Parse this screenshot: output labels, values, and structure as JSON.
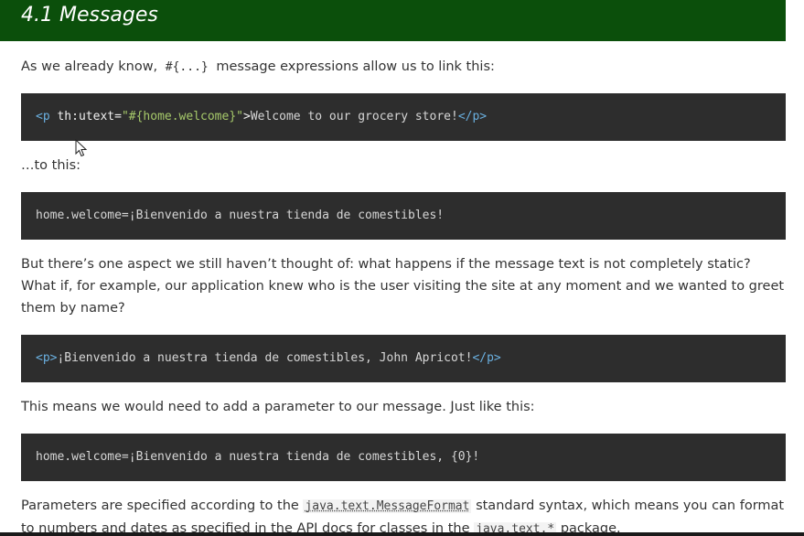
{
  "section": {
    "title": "4.1 Messages"
  },
  "para1": {
    "before": "As we already know,",
    "code": "#{...}",
    "after": "message expressions allow us to link this:"
  },
  "code1": {
    "open_tag": "<p",
    "attr": " th:utext=",
    "value": "\"#{home.welcome}\"",
    "close_bracket": ">",
    "text": "Welcome to our grocery store!",
    "end_tag": "</p>"
  },
  "para2": {
    "text": "…to this:"
  },
  "code2": {
    "text": "home.welcome=¡Bienvenido a nuestra tienda de comestibles!"
  },
  "para3": {
    "text": "But there’s one aspect we still haven’t thought of: what happens if the message text is not completely static? What if, for example, our application knew who is the user visiting the site at any moment and we wanted to greet them by name?"
  },
  "code3": {
    "open_tag": "<p>",
    "text": "¡Bienvenido a nuestra tienda de comestibles, John Apricot!",
    "end_tag": "</p>"
  },
  "para4": {
    "text": "This means we would need to add a parameter to our message. Just like this:"
  },
  "code4": {
    "text": "home.welcome=¡Bienvenido a nuestra tienda de comestibles, {0}!"
  },
  "para5": {
    "before": "Parameters are specified according to the",
    "link1": "java.text.MessageFormat",
    "middle": "standard syntax, which means you can format to numbers and dates as specified in the API docs for classes in the",
    "link2": "java.text.*",
    "after": "package."
  }
}
